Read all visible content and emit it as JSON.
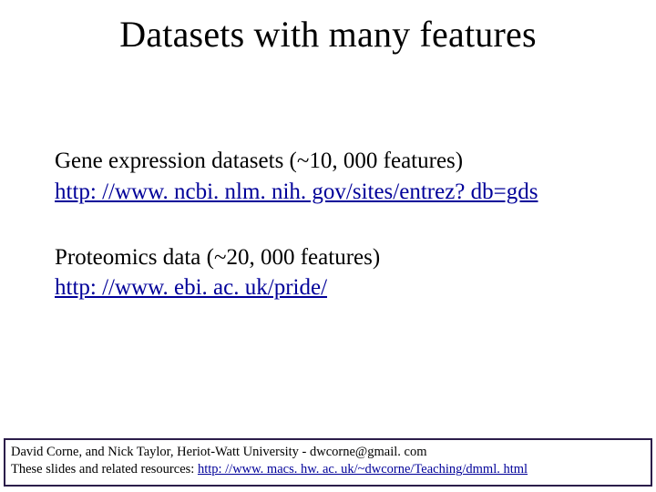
{
  "slide": {
    "title": "Datasets with many features",
    "blocks": [
      {
        "text": "Gene expression datasets (~10, 000 features)",
        "link": "http: //www. ncbi. nlm. nih. gov/sites/entrez? db=gds"
      },
      {
        "text": "Proteomics data (~20, 000 features)",
        "link": "http: //www. ebi. ac. uk/pride/"
      }
    ],
    "footer": {
      "line1": "David Corne, and Nick Taylor,  Heriot-Watt University  -  dwcorne@gmail. com",
      "line2_prefix": "These slides and related resources:   ",
      "line2_link": "http: //www. macs. hw. ac. uk/~dwcorne/Teaching/dmml. html"
    }
  }
}
